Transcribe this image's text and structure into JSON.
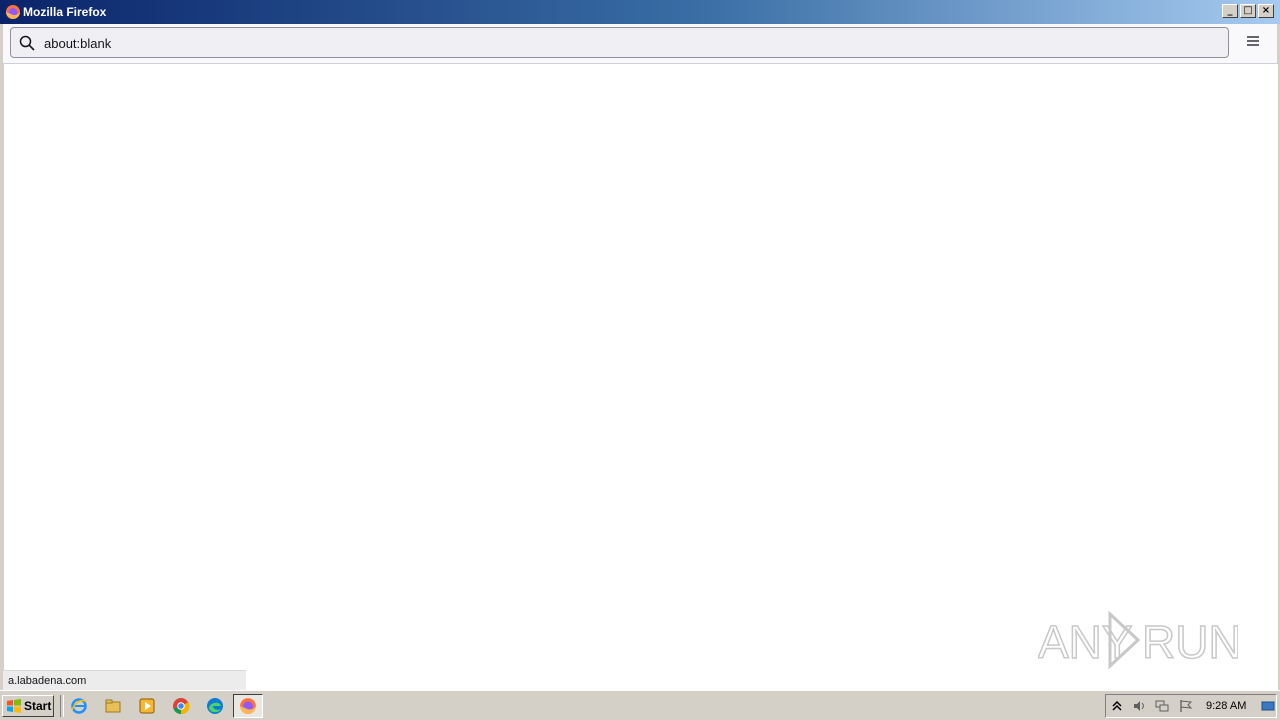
{
  "window": {
    "title": "Mozilla Firefox"
  },
  "toolbar": {
    "url": "about:blank"
  },
  "status": {
    "text": "a.labadena.com"
  },
  "taskbar": {
    "start_label": "Start",
    "clock": "9:28 AM"
  },
  "watermark": {
    "text": "ANY RUN"
  },
  "colors": {
    "titlebar_start": "#0a246a",
    "titlebar_end": "#a6caf0",
    "taskbar": "#d4d0c8"
  }
}
